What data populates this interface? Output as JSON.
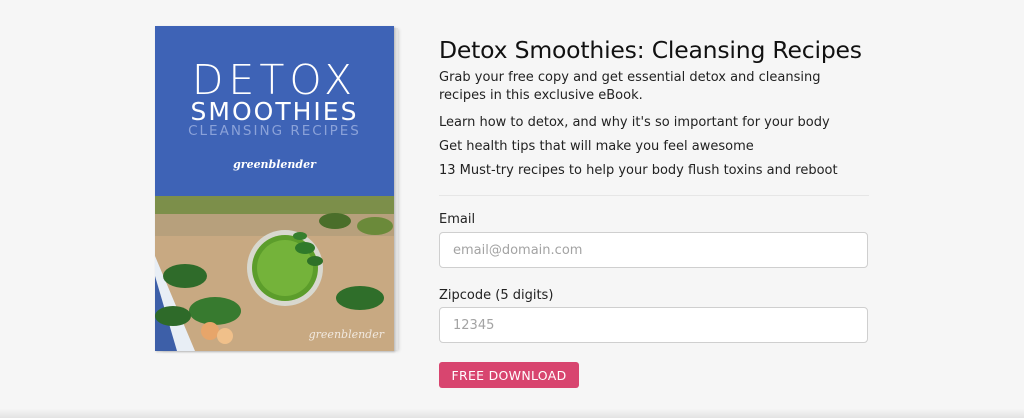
{
  "ebook": {
    "cover_title_line1": "DETOX",
    "cover_title_line2": "SMOOTHIES",
    "cover_title_line3": "CLEANSING RECIPES",
    "cover_logo": "greenblender",
    "photo_logo": "greenblender"
  },
  "offer": {
    "title": "Detox Smoothies: Cleansing Recipes",
    "intro": "Grab your free copy and get essential detox and cleansing recipes in this exclusive eBook.",
    "bullets": [
      "Learn how to detox, and why it's so important for your body",
      "Get health tips that will make you feel awesome",
      "13 Must-try recipes to help your body flush toxins and reboot"
    ]
  },
  "form": {
    "email_label": "Email",
    "email_placeholder": "email@domain.com",
    "email_value": "",
    "zip_label": "Zipcode (5 digits)",
    "zip_placeholder": "12345",
    "zip_value": "",
    "submit_label": "FREE DOWNLOAD"
  },
  "colors": {
    "cover_blue": "#3e63b6",
    "button_pink": "#d8456f",
    "page_bg": "#f6f6f6"
  }
}
